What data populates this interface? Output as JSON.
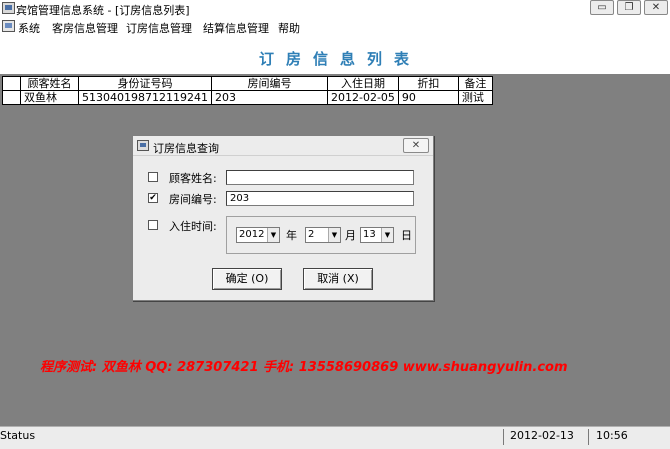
{
  "window": {
    "title": "宾馆管理信息系统 - [订房信息列表]",
    "controls": {
      "minimize": "▭",
      "restore": "❐",
      "close": "✕"
    }
  },
  "menu": {
    "items": [
      "系统",
      "客房信息管理",
      "订房信息管理",
      "结算信息管理",
      "帮助"
    ]
  },
  "page_title": "订房信息列表",
  "table": {
    "columns": [
      "顾客姓名",
      "身份证号码",
      "房间编号",
      "入住日期",
      "折扣",
      "备注"
    ],
    "rows": [
      [
        "双鱼林",
        "513040198712119241",
        "203",
        "2012-02-05",
        "90",
        "测试"
      ]
    ]
  },
  "dialog": {
    "title": "订房信息查询",
    "close_label": "✕",
    "fields": {
      "customer_name": {
        "label": "顾客姓名:",
        "value": "",
        "checked": false
      },
      "room_number": {
        "label": "房间编号:",
        "value": "203",
        "checked": true
      },
      "checkin_time": {
        "label": "入住时间:",
        "checked": false
      }
    },
    "date": {
      "year": "2012",
      "year_unit": "年",
      "month": "2",
      "month_unit": "月",
      "day": "13",
      "day_unit": "日"
    },
    "ok_label": "确定 (O)",
    "cancel_label": "取消 (X)"
  },
  "footer_note": "程序测试: 双鱼林   QQ: 287307421   手机: 13558690869   www.shuangyulin.com",
  "status": {
    "text": "Status",
    "date": "2012-02-13",
    "time": "10:56"
  }
}
